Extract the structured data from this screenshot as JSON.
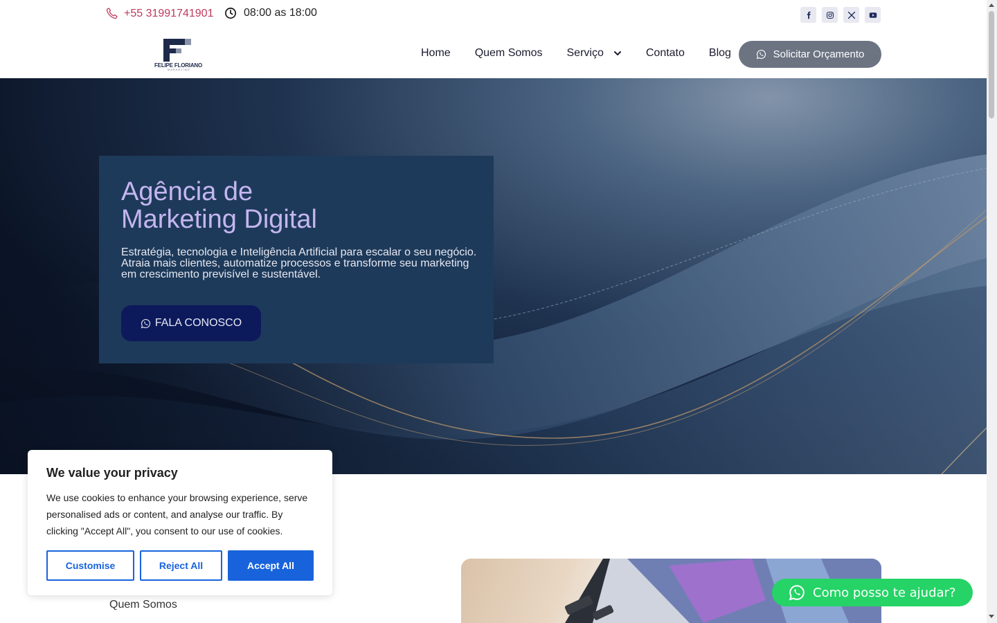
{
  "topbar": {
    "phone": "+55 31991741901",
    "hours": "08:00 as 18:00",
    "social": [
      {
        "name": "facebook-icon",
        "glyph": "f"
      },
      {
        "name": "instagram-icon",
        "glyph": ""
      },
      {
        "name": "x-icon",
        "glyph": "X"
      },
      {
        "name": "youtube-icon",
        "glyph": ""
      }
    ]
  },
  "header": {
    "logo_text": "FELIPE FLORIANO",
    "logo_sub": "MARKETING",
    "nav": {
      "home": "Home",
      "quem_somos": "Quem Somos",
      "servico": "Serviço",
      "contato": "Contato",
      "blog": "Blog"
    },
    "cta": "Solicitar Orçamento"
  },
  "hero": {
    "title": "Agência de\nMarketing Digital",
    "text_1": "Estratégia, tecnologia e Inteligência Artificial para escalar o seu negócio.",
    "text_2": "Atraia mais clientes, automatize processos e transforme seu marketing em crescimento previsível e sustentável.",
    "button": "FALA CONOSCO"
  },
  "section": {
    "label": "Quem Somos"
  },
  "cookie": {
    "title": "We value your privacy",
    "text": "We use cookies to enhance your browsing experience, serve personalised ads or content, and analyse our traffic. By clicking \"Accept All\", you consent to our use of cookies.",
    "customise": "Customise",
    "reject": "Reject All",
    "accept": "Accept All"
  },
  "whatsapp": {
    "label": "Como posso te ajudar?"
  },
  "colors": {
    "accent_phone": "#c0395c",
    "hero_title": "#c4b6f0",
    "hero_box": "#1e3a5a",
    "hero_button": "#0c1a5c",
    "cta_button": "#6c7482",
    "cookie_blue": "#1863dc",
    "whatsapp_green": "#25d366"
  }
}
